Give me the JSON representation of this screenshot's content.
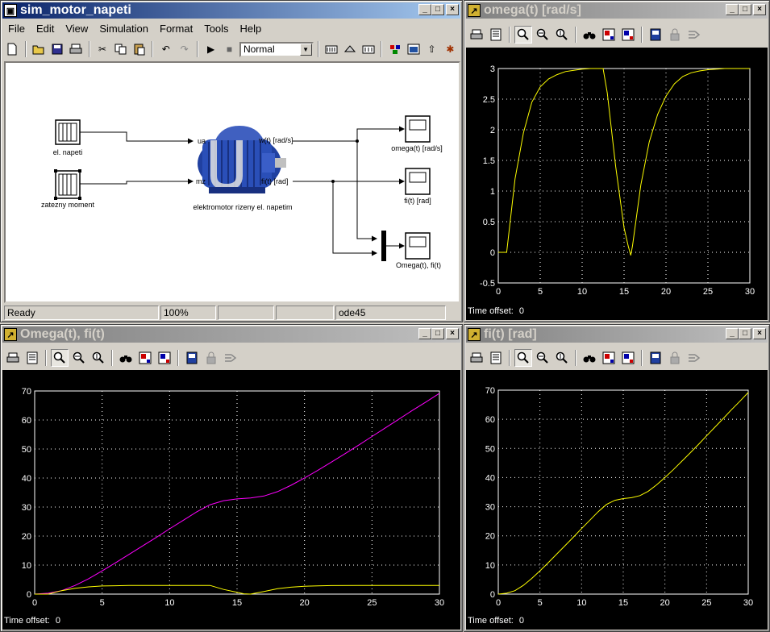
{
  "simulink": {
    "title": "sim_motor_napeti",
    "menu": [
      "File",
      "Edit",
      "View",
      "Simulation",
      "Format",
      "Tools",
      "Help"
    ],
    "sim_mode": "Normal",
    "blocks": {
      "source1": "el. napeti",
      "source2": "zatezny moment",
      "motor": "elektromotor rizeny el. napetim",
      "port_in1": "ua",
      "port_in2": "mz",
      "port_out1": "w(t) [rad/s]",
      "port_out2": "fi(t) [rad]",
      "scope1": "omega(t) [rad/s]",
      "scope2": "fi(t) [rad]",
      "scope3": "Omega(t), fi(t)"
    },
    "status": {
      "state": "Ready",
      "zoom": "100%",
      "f1": "",
      "f2": "",
      "solver": "ode45"
    }
  },
  "scope_omega": {
    "title": "omega(t) [rad/s]",
    "time_offset_label": "Time offset:",
    "time_offset_value": "0"
  },
  "scope_both": {
    "title": "Omega(t), fi(t)",
    "time_offset_label": "Time offset:",
    "time_offset_value": "0"
  },
  "scope_fi": {
    "title": "fi(t) [rad]",
    "time_offset_label": "Time offset:",
    "time_offset_value": "0"
  },
  "colors": {
    "yellow": "#ffff00",
    "magenta": "#ff00ff",
    "grid": "#ffffff",
    "axis": "#ffffff"
  },
  "chart_data": [
    {
      "type": "line",
      "xlim": [
        0,
        30
      ],
      "ylim": [
        -0.5,
        3
      ],
      "xticks": [
        "0",
        "5",
        "10",
        "15",
        "20",
        "25",
        "30"
      ],
      "yticks": [
        "-0.5",
        "0",
        "0.5",
        "1",
        "1.5",
        "2",
        "2.5",
        "3"
      ],
      "grid": true,
      "series": [
        {
          "color": "#ffff00",
          "x": [
            0,
            1,
            1.5,
            2,
            3,
            4,
            5,
            6,
            7,
            8,
            9,
            10,
            11,
            12,
            12.5,
            13,
            13.5,
            14,
            14.5,
            15,
            15.5,
            15.8,
            16,
            16.5,
            17,
            18,
            19,
            20,
            21,
            22,
            23,
            24,
            25,
            26,
            27,
            28,
            30
          ],
          "y": [
            0,
            0,
            0.6,
            1.2,
            1.95,
            2.45,
            2.7,
            2.83,
            2.9,
            2.95,
            2.97,
            2.99,
            3,
            3,
            3,
            2.6,
            2.0,
            1.4,
            0.9,
            0.4,
            0.1,
            -0.05,
            0.1,
            0.6,
            1.1,
            1.8,
            2.25,
            2.55,
            2.75,
            2.87,
            2.93,
            2.96,
            2.98,
            2.99,
            3,
            3,
            3
          ]
        }
      ]
    },
    {
      "type": "line",
      "xlim": [
        0,
        30
      ],
      "ylim": [
        0,
        70
      ],
      "xticks": [
        "0",
        "5",
        "10",
        "15",
        "20",
        "25",
        "30"
      ],
      "yticks": [
        "0",
        "10",
        "20",
        "30",
        "40",
        "50",
        "60",
        "70"
      ],
      "grid": true,
      "series": [
        {
          "color": "#ff00ff",
          "x": [
            0,
            1,
            2,
            3,
            4,
            5,
            6,
            7,
            8,
            9,
            10,
            11,
            12,
            13,
            14,
            15,
            16,
            17,
            18,
            19,
            20,
            21,
            22,
            23,
            24,
            25,
            26,
            27,
            28,
            29,
            30
          ],
          "y": [
            0,
            0.3,
            1.2,
            3,
            5.3,
            8,
            10.8,
            13.7,
            16.6,
            19.5,
            22.5,
            25.4,
            28.3,
            30.8,
            32.2,
            32.8,
            33.1,
            33.8,
            35.3,
            37.5,
            40,
            42.7,
            45.5,
            48.4,
            51.3,
            54.3,
            57.3,
            60.3,
            63.3,
            66.2,
            69.2
          ]
        },
        {
          "color": "#ffff00",
          "x": [
            0,
            1,
            1.5,
            2,
            3,
            4,
            5,
            6,
            7,
            8,
            9,
            10,
            11,
            12,
            13,
            14,
            15,
            15.5,
            16,
            17,
            18,
            19,
            20,
            21,
            22,
            24,
            26,
            28,
            30
          ],
          "y": [
            0,
            0,
            0.6,
            1.2,
            2,
            2.5,
            2.8,
            2.9,
            3,
            3,
            3,
            3,
            3,
            3,
            3,
            1.6,
            0.6,
            0.1,
            0,
            0.9,
            1.9,
            2.4,
            2.7,
            2.85,
            2.95,
            3,
            3,
            3,
            3
          ]
        }
      ]
    },
    {
      "type": "line",
      "xlim": [
        0,
        30
      ],
      "ylim": [
        0,
        70
      ],
      "xticks": [
        "0",
        "5",
        "10",
        "15",
        "20",
        "25",
        "30"
      ],
      "yticks": [
        "0",
        "10",
        "20",
        "30",
        "40",
        "50",
        "60",
        "70"
      ],
      "grid": true,
      "series": [
        {
          "color": "#ffff00",
          "x": [
            0,
            1,
            2,
            3,
            4,
            5,
            6,
            7,
            8,
            9,
            10,
            11,
            12,
            13,
            14,
            15,
            16,
            17,
            18,
            19,
            20,
            21,
            22,
            23,
            24,
            25,
            26,
            27,
            28,
            29,
            30
          ],
          "y": [
            0,
            0.3,
            1.2,
            3,
            5.3,
            8,
            10.8,
            13.7,
            16.6,
            19.5,
            22.5,
            25.4,
            28.3,
            30.8,
            32.2,
            32.8,
            33.1,
            33.8,
            35.3,
            37.5,
            40,
            42.7,
            45.5,
            48.4,
            51.3,
            54.3,
            57.3,
            60.3,
            63.3,
            66.2,
            69.2
          ]
        }
      ]
    }
  ]
}
